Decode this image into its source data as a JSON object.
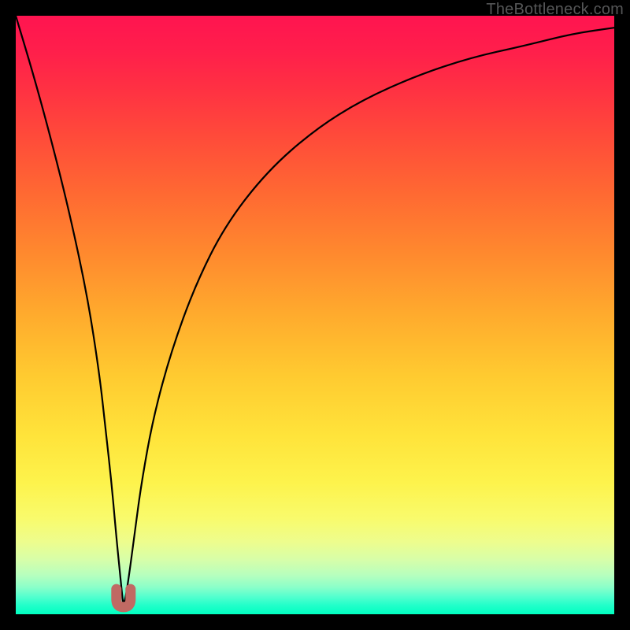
{
  "watermark": "TheBottleneck.com",
  "chart_data": {
    "type": "line",
    "title": "",
    "xlabel": "",
    "ylabel": "",
    "xlim": [
      0,
      100
    ],
    "ylim": [
      0,
      100
    ],
    "series": [
      {
        "name": "bottleneck-curve",
        "x": [
          0,
          3,
          6,
          9,
          12,
          14,
          15,
          16,
          16.8,
          17.4,
          17.8,
          18.0,
          18.4,
          19.0,
          19.8,
          21,
          23,
          26,
          30,
          35,
          42,
          50,
          58,
          67,
          76,
          85,
          93,
          100
        ],
        "values": [
          100,
          90,
          79,
          67,
          53,
          40,
          31,
          22,
          13,
          7,
          3,
          1.5,
          3,
          7,
          13,
          22,
          33,
          44,
          55,
          65,
          74,
          81,
          86,
          90,
          93,
          95,
          97,
          98
        ]
      }
    ],
    "annotations": [
      {
        "name": "marker-curve",
        "shape": "u",
        "x_center": 18.0,
        "y_range": [
          1.2,
          4.2
        ],
        "color": "#c06a63"
      }
    ],
    "gradient": {
      "direction": "vertical",
      "stops": [
        {
          "pos": 0.0,
          "color": "#ff1450"
        },
        {
          "pos": 0.3,
          "color": "#ff6a32"
        },
        {
          "pos": 0.6,
          "color": "#ffca30"
        },
        {
          "pos": 0.84,
          "color": "#f9fb6c"
        },
        {
          "pos": 1.0,
          "color": "#00ffc0"
        }
      ]
    }
  }
}
